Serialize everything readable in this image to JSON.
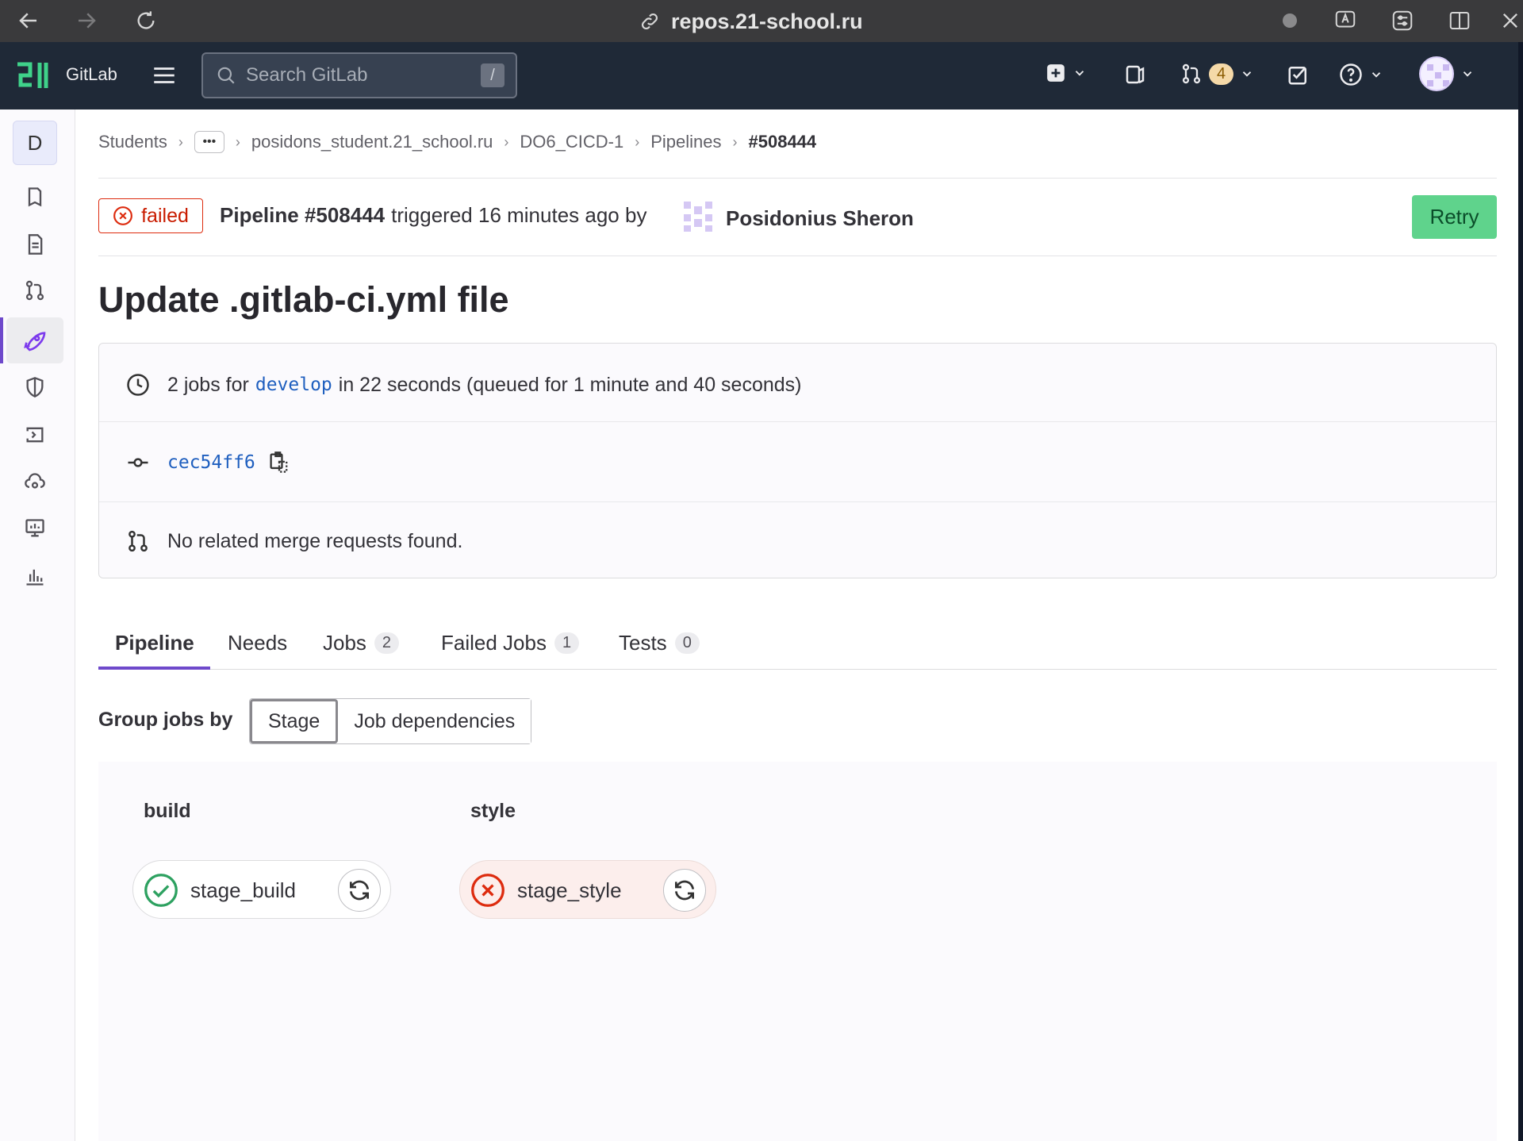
{
  "browser": {
    "url": "repos.21-school.ru"
  },
  "header": {
    "brand": "GitLab",
    "search_placeholder": "Search GitLab",
    "search_shortcut": "/",
    "merge_requests_count": "4"
  },
  "sidebar": {
    "project_initial": "D"
  },
  "breadcrumb": {
    "items": [
      "Students",
      "posidons_student.21_school.ru",
      "DO6_CICD-1",
      "Pipelines"
    ],
    "current": "#508444"
  },
  "pipeline": {
    "status": "failed",
    "id_label": "Pipeline #508444",
    "triggered_text": "triggered 16 minutes ago by",
    "user_name": "Posidonius Sheron",
    "retry_label": "Retry",
    "title": "Update .gitlab-ci.yml file",
    "jobs_prefix": "2 jobs for",
    "branch": "develop",
    "jobs_suffix": "in 22 seconds (queued for 1 minute and 40 seconds)",
    "commit_sha": "cec54ff6",
    "merge_requests_text": "No related merge requests found."
  },
  "tabs": [
    {
      "label": "Pipeline",
      "count": null
    },
    {
      "label": "Needs",
      "count": null
    },
    {
      "label": "Jobs",
      "count": "2"
    },
    {
      "label": "Failed Jobs",
      "count": "1"
    },
    {
      "label": "Tests",
      "count": "0"
    }
  ],
  "group_by": {
    "label": "Group jobs by",
    "options": [
      "Stage",
      "Job dependencies"
    ],
    "selected": "Stage"
  },
  "stages": [
    {
      "name": "build",
      "job": "stage_build",
      "status": "success"
    },
    {
      "name": "style",
      "job": "stage_style",
      "status": "failed"
    }
  ],
  "colors": {
    "failed": "#dd2b0e",
    "success": "#2da160",
    "accent": "#6e49cb",
    "retry_bg": "#5fd38c"
  }
}
